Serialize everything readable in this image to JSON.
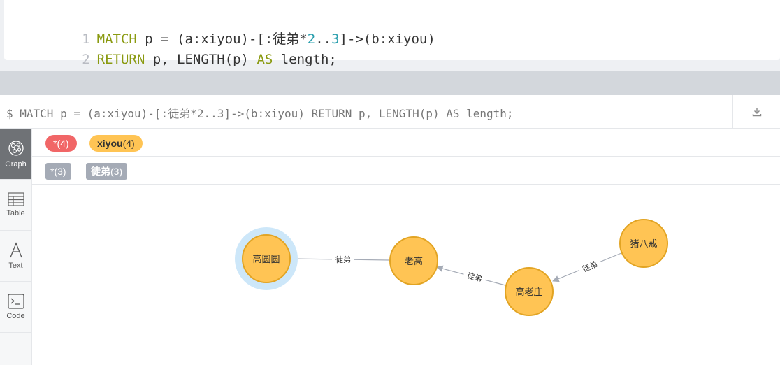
{
  "editor": {
    "line1": {
      "num": "1",
      "kw": "MATCH",
      "a": " p = (a:xiyou)-[:徒弟*",
      "n1": "2",
      "dots": "..",
      "n2": "3",
      "b": "]->(b:xiyou)"
    },
    "line2": {
      "num": "2",
      "kw1": "RETURN",
      "a": " p, LENGTH(p) ",
      "kw2": "AS",
      "b": " length;"
    }
  },
  "frame": {
    "query": "$ MATCH p = (a:xiyou)-[:徒弟*2..3]->(b:xiyou) RETURN p, LENGTH(p) AS length;",
    "download_icon": "download-icon"
  },
  "sidebar": {
    "items": [
      {
        "label": "Graph",
        "icon": "graph-icon"
      },
      {
        "label": "Table",
        "icon": "table-icon"
      },
      {
        "label": "Text",
        "icon": "text-icon"
      },
      {
        "label": "Code",
        "icon": "code-icon"
      }
    ]
  },
  "legend": {
    "node_all": {
      "name": "*",
      "count": "(4)"
    },
    "node_xiyou": {
      "name": "xiyou",
      "count": "(4)"
    },
    "rel_all": {
      "name": "*",
      "count": "(3)"
    },
    "rel_tudi": {
      "name": "徒弟",
      "count": "(3)"
    }
  },
  "graph": {
    "nodes": [
      {
        "label": "高圆圆"
      },
      {
        "label": "老高"
      },
      {
        "label": "高老庄"
      },
      {
        "label": "猪八戒"
      }
    ],
    "edges": [
      {
        "label": "徒弟"
      },
      {
        "label": "徒弟"
      },
      {
        "label": "徒弟"
      }
    ],
    "colors": {
      "node_fill": "#ffc454",
      "node_stroke": "#e2a423",
      "selected_halo": "#cde7f9",
      "edge": "#a5abb6"
    }
  }
}
